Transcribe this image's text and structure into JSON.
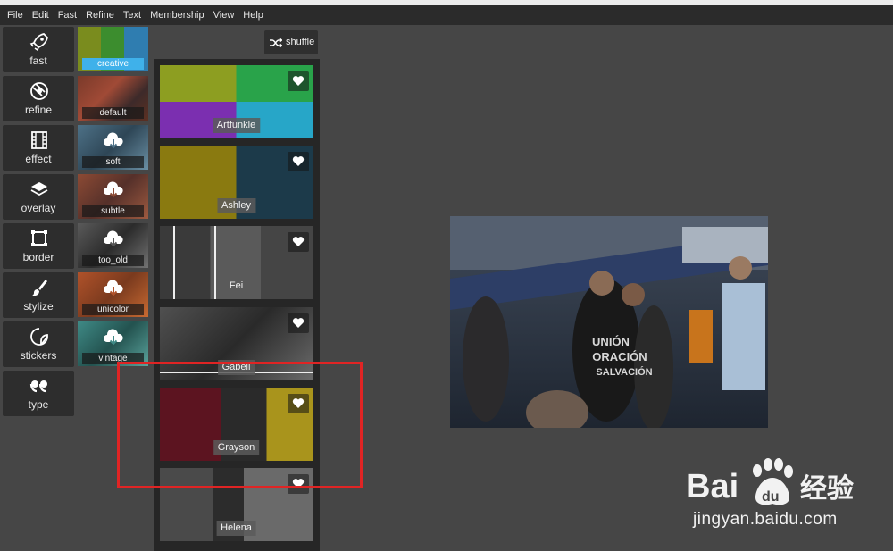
{
  "menu": [
    "File",
    "Edit",
    "Fast",
    "Refine",
    "Text",
    "Membership",
    "View",
    "Help"
  ],
  "tools": [
    {
      "label": "fast",
      "icon": "rocket-icon"
    },
    {
      "label": "refine",
      "icon": "aperture-icon"
    },
    {
      "label": "effect",
      "icon": "film-icon"
    },
    {
      "label": "overlay",
      "icon": "layers-icon"
    },
    {
      "label": "border",
      "icon": "frame-icon"
    },
    {
      "label": "stylize",
      "icon": "brush-icon"
    },
    {
      "label": "stickers",
      "icon": "sticker-icon"
    },
    {
      "label": "type",
      "icon": "quote-icon"
    }
  ],
  "presets": [
    {
      "label": "creative",
      "active": true,
      "download": false
    },
    {
      "label": "default",
      "active": false,
      "download": false
    },
    {
      "label": "soft",
      "active": false,
      "download": true
    },
    {
      "label": "subtle",
      "active": false,
      "download": true
    },
    {
      "label": "too_old",
      "active": false,
      "download": true
    },
    {
      "label": "unicolor",
      "active": false,
      "download": true
    },
    {
      "label": "vintage",
      "active": false,
      "download": true
    }
  ],
  "shuffle_label": "shuffle",
  "filters": [
    "Artfunkle",
    "Ashley",
    "Fei",
    "Gabell",
    "Grayson",
    "Helena"
  ],
  "watermark": {
    "brand": "Bai du 经验",
    "url": "jingyan.baidu.com"
  },
  "colors": {
    "accent": "#3fb1ea",
    "highlight": "#e02424",
    "panel": "#262626",
    "background": "#464646"
  }
}
